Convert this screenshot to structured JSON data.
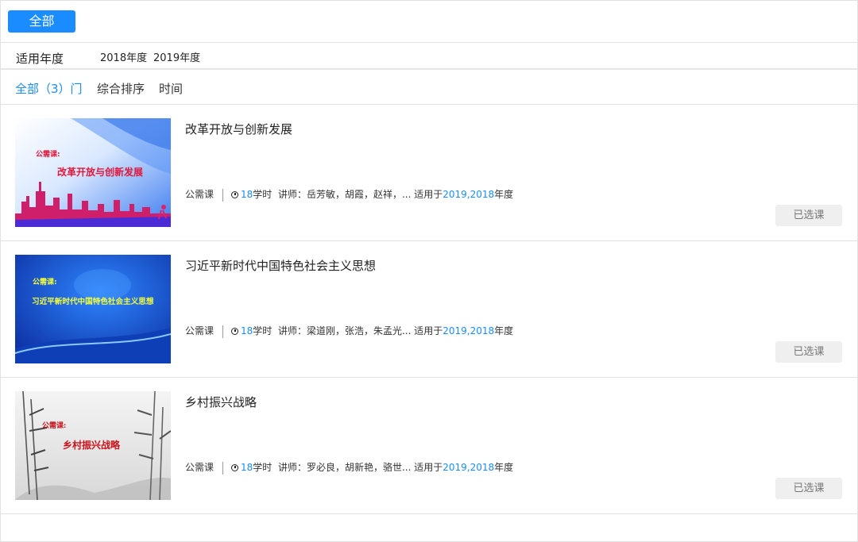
{
  "filter": {
    "all_label": "全部"
  },
  "year_filter": {
    "label": "适用年度",
    "options": [
      "2018年度",
      "2019年度"
    ]
  },
  "sort": {
    "count_label": "全部（3）门",
    "comprehensive": "综合排序",
    "time": "时间"
  },
  "courses": [
    {
      "title": "改革开放与创新发展",
      "type": "公需课",
      "hours": "18",
      "hours_unit": "学时",
      "lecturer_prefix": "讲师：",
      "lecturers": "岳芳敏，胡霞，赵祥，...",
      "years_prefix": "适用于",
      "years": "2019,2018",
      "years_suffix": "年度",
      "status": "已选课",
      "thumb_tag": "公需课:",
      "thumb_title": "改革开放与创新发展"
    },
    {
      "title": "习近平新时代中国特色社会主义思想",
      "type": "公需课",
      "hours": "18",
      "hours_unit": "学时",
      "lecturer_prefix": "讲师：",
      "lecturers": "梁道刚，张浩，朱孟光...",
      "years_prefix": "适用于",
      "years": "2019,2018",
      "years_suffix": "年度",
      "status": "已选课",
      "thumb_tag": "公需课:",
      "thumb_title": "习近平新时代中国特色社会主义思想"
    },
    {
      "title": "乡村振兴战略",
      "type": "公需课",
      "hours": "18",
      "hours_unit": "学时",
      "lecturer_prefix": "讲师：",
      "lecturers": "罗必良，胡新艳，骆世...",
      "years_prefix": "适用于",
      "years": "2019,2018",
      "years_suffix": "年度",
      "status": "已选课",
      "thumb_tag": "公需课:",
      "thumb_title": "乡村振兴战略"
    }
  ],
  "colors": {
    "accent": "#1a8cff",
    "muted_button": "#efefef"
  }
}
